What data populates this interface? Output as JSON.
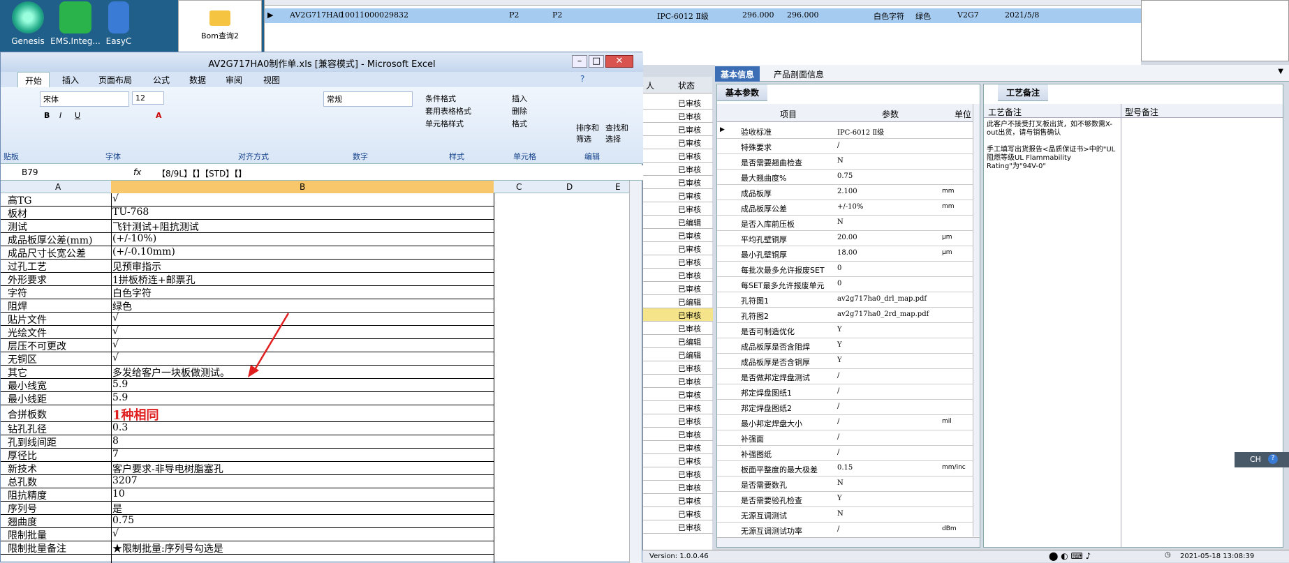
{
  "desktop": {
    "icons": [
      "Genesis",
      "EMS.Integ...",
      "EasyC"
    ],
    "bom_label": "Bom查询2"
  },
  "top_grid": {
    "row": [
      "AV2G717HA0",
      "10011000029832",
      "P2",
      "P2",
      "IPC-6012 Ⅱ级",
      "296.000",
      "296.000",
      "白色字符",
      "绿色",
      "V2G7",
      "2021/5/8"
    ]
  },
  "status_column": {
    "header_left": "人",
    "header": "状态",
    "rows": [
      "已审核",
      "已审核",
      "已审核",
      "已审核",
      "已审核",
      "已审核",
      "已审核",
      "已审核",
      "已审核",
      "已编辑",
      "已审核",
      "已审核",
      "已审核",
      "已审核",
      "已审核",
      "已编辑",
      "已审核",
      "已审核",
      "已编辑",
      "已编辑",
      "已审核",
      "已审核",
      "已审核",
      "已审核",
      "已审核",
      "已审核",
      "已审核",
      "已审核",
      "已审核",
      "已审核",
      "已审核",
      "已审核",
      "已审核"
    ]
  },
  "right_tabs": [
    "基本信息",
    "产品剖面信息"
  ],
  "param_panel": {
    "title": "基本参数",
    "headers": [
      "项目",
      "参数",
      "单位"
    ],
    "rows": [
      {
        "item": "验收标准",
        "value": "IPC-6012 Ⅱ级",
        "unit": ""
      },
      {
        "item": "特殊要求",
        "value": "/",
        "unit": ""
      },
      {
        "item": "是否需要翘曲检查",
        "value": "N",
        "unit": ""
      },
      {
        "item": "最大翘曲度%",
        "value": "0.75",
        "unit": ""
      },
      {
        "item": "成品板厚",
        "value": "2.100",
        "unit": "mm"
      },
      {
        "item": "成品板厚公差",
        "value": "+/-10%",
        "unit": "mm"
      },
      {
        "item": "是否入库前压板",
        "value": "N",
        "unit": ""
      },
      {
        "item": "平均孔壁铜厚",
        "value": "20.00",
        "unit": "μm"
      },
      {
        "item": "最小孔壁铜厚",
        "value": "18.00",
        "unit": "μm"
      },
      {
        "item": "每批次最多允许报废SET",
        "value": "0",
        "unit": ""
      },
      {
        "item": "每SET最多允许报废单元",
        "value": "0",
        "unit": ""
      },
      {
        "item": "孔符图1",
        "value": "av2g717ha0_drl_map.pdf",
        "unit": ""
      },
      {
        "item": "孔符图2",
        "value": "av2g717ha0_2rd_map.pdf",
        "unit": ""
      },
      {
        "item": "是否可制造优化",
        "value": "Y",
        "unit": ""
      },
      {
        "item": "成品板厚是否含阻焊",
        "value": "Y",
        "unit": ""
      },
      {
        "item": "成品板厚是否含铜厚",
        "value": "Y",
        "unit": ""
      },
      {
        "item": "是否做邦定焊盘测试",
        "value": "/",
        "unit": ""
      },
      {
        "item": "邦定焊盘图纸1",
        "value": "/",
        "unit": ""
      },
      {
        "item": "邦定焊盘图纸2",
        "value": "/",
        "unit": ""
      },
      {
        "item": "最小邦定焊盘大小",
        "value": "/",
        "unit": "mil"
      },
      {
        "item": "补强面",
        "value": "/",
        "unit": ""
      },
      {
        "item": "补强图纸",
        "value": "/",
        "unit": ""
      },
      {
        "item": "板面平整度的最大极差",
        "value": "0.15",
        "unit": "mm/inc"
      },
      {
        "item": "是否需要数孔",
        "value": "N",
        "unit": ""
      },
      {
        "item": "是否需要验孔检查",
        "value": "Y",
        "unit": ""
      },
      {
        "item": "无源互调测试",
        "value": "N",
        "unit": ""
      },
      {
        "item": "无源互调测试功率",
        "value": "/",
        "unit": "dBm"
      }
    ]
  },
  "craft_panel": {
    "title": "工艺备注",
    "col1": "工艺备注",
    "col2": "型号备注",
    "note1": "此客户不接受打叉板出货，如不够数需X-out出货，请与销售确认",
    "note2": "手工填写出货报告<品质保证书>中的\"UL阻燃等级UL Flammability Rating\"为\"94V-0\""
  },
  "excel": {
    "title": "AV2G717HA0制作单.xls [兼容模式] - Microsoft Excel",
    "tabs": [
      "开始",
      "插入",
      "页面布局",
      "公式",
      "数据",
      "审阅",
      "视图"
    ],
    "ribbon": {
      "font_name": "宋体",
      "font_size": "12",
      "number_format": "常规",
      "groups": [
        "贴板",
        "字体",
        "对齐方式",
        "数字",
        "样式",
        "单元格",
        "编辑"
      ],
      "style_buttons": [
        "条件格式",
        "套用表格格式",
        "单元格样式"
      ],
      "cell_buttons": [
        "插入",
        "删除",
        "格式"
      ],
      "edit_buttons": [
        "排序和筛选",
        "查找和选择"
      ]
    },
    "name_box": "B79",
    "formula": "【8/9L】【】【STD】【】",
    "columns": [
      "A",
      "B",
      "C",
      "D",
      "E"
    ],
    "rows": [
      {
        "a": "高TG",
        "b": "√"
      },
      {
        "a": "板材",
        "b": "TU-768"
      },
      {
        "a": "测试",
        "b": "飞针测试+阻抗测试"
      },
      {
        "a": "成品板厚公差(mm)",
        "b": "(+/-10%)"
      },
      {
        "a": "成品尺寸长宽公差",
        "b": "(+/-0.10mm)"
      },
      {
        "a": "过孔工艺",
        "b": "见预审指示"
      },
      {
        "a": "外形要求",
        "b": "1拼板桥连+邮票孔"
      },
      {
        "a": "字符",
        "b": "白色字符"
      },
      {
        "a": "阻焊",
        "b": "绿色"
      },
      {
        "a": "贴片文件",
        "b": "√"
      },
      {
        "a": "光绘文件",
        "b": "√"
      },
      {
        "a": "层压不可更改",
        "b": "√"
      },
      {
        "a": "无铜区",
        "b": "√"
      },
      {
        "a": "其它",
        "b": "多发给客户一块板做测试。"
      },
      {
        "a": "最小线宽",
        "b": "5.9"
      },
      {
        "a": "最小线距",
        "b": "5.9"
      },
      {
        "a": "合拼板数",
        "b": "1种相同"
      },
      {
        "a": "钻孔孔径",
        "b": "0.3"
      },
      {
        "a": "孔到线间距",
        "b": "8"
      },
      {
        "a": "厚径比",
        "b": "7"
      },
      {
        "a": "新技术",
        "b": "客户要求-非导电树脂塞孔"
      },
      {
        "a": "总孔数",
        "b": "3207"
      },
      {
        "a": "阻抗精度",
        "b": "10"
      },
      {
        "a": "序列号",
        "b": "是"
      },
      {
        "a": "翘曲度",
        "b": "0.75"
      },
      {
        "a": "限制批量",
        "b": "√"
      },
      {
        "a": "限制批量备注",
        "b": "★限制批量:序列号勾选是"
      }
    ]
  },
  "status_bar": {
    "version": "Version: 1.0.0.46",
    "datetime": "2021-05-18 13:08:39",
    "ime": "CH"
  },
  "colors": {
    "arrow": "#e02020",
    "highlight_text": "#e02020",
    "selection": "#a6cbf0"
  }
}
